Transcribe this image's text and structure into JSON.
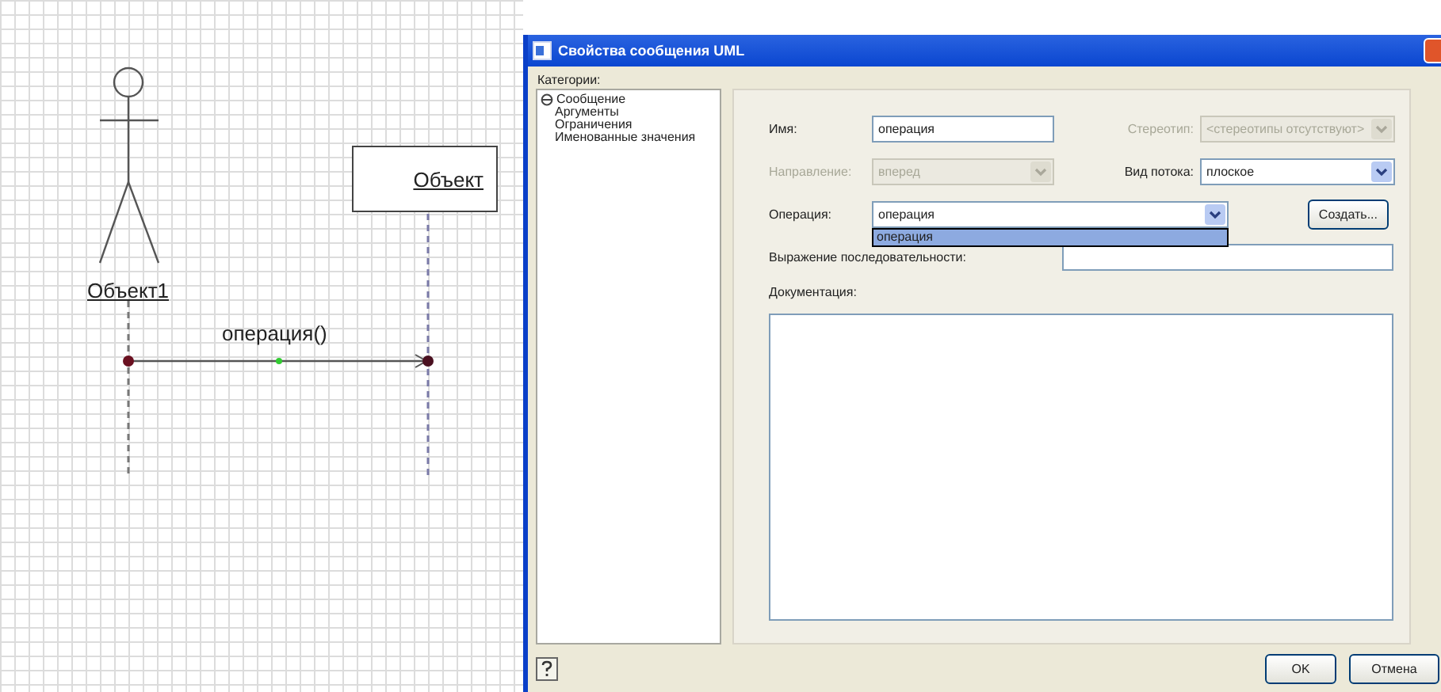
{
  "diagram": {
    "actor": {
      "name": "Объект1"
    },
    "object": {
      "name": "Объект"
    },
    "message": {
      "label": "операция()"
    }
  },
  "dialog": {
    "title": "Свойства сообщения UML",
    "categories_label": "Категории:",
    "categories": [
      {
        "label": "Сообщение",
        "selected": true
      },
      {
        "label": "Аргументы",
        "selected": false
      },
      {
        "label": "Ограничения",
        "selected": false
      },
      {
        "label": "Именованные значения",
        "selected": false
      }
    ],
    "fields": [
      {
        "kind": "text",
        "label": "Имя:",
        "value": "операция",
        "disabled": false
      },
      {
        "kind": "select",
        "label": "Стереотип:",
        "value": "<стереотипы отсутствуют>",
        "disabled": true
      },
      {
        "kind": "select",
        "label": "Направление:",
        "value": "вперед",
        "disabled": true
      },
      {
        "kind": "select",
        "label": "Вид потока:",
        "value": "плоское",
        "disabled": false
      }
    ],
    "operation": {
      "label": "Операция:",
      "value": "операция",
      "expanded": true,
      "options": [
        {
          "label": "операция",
          "selected": true
        }
      ],
      "create_button": "Создать..."
    },
    "sequence": {
      "label": "Выражение последовательности:"
    },
    "documentation": {
      "label": "Документация:"
    },
    "buttons": [
      "OK",
      "Отмена"
    ]
  }
}
